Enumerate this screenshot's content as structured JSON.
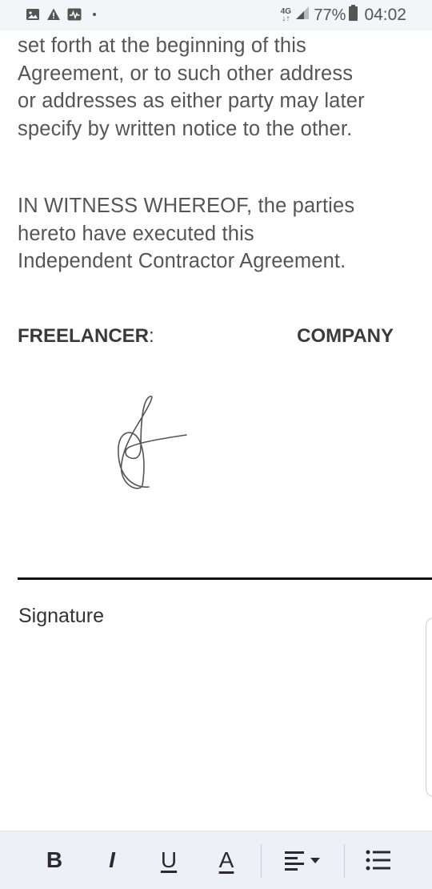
{
  "status_bar": {
    "left_icons": [
      "image-icon",
      "warning-icon",
      "activity-icon",
      "notification-dot"
    ],
    "network_type": "4G",
    "battery_percent": "77%",
    "time": "04:02"
  },
  "document": {
    "paragraph1_lines": [
      "set forth at the beginning of this",
      "Agreement, or to such other address",
      "or addresses as either party may later",
      "specify by written notice to the other."
    ],
    "paragraph2_lines": [
      "IN WITNESS WHEREOF, the parties",
      "hereto have executed this",
      "Independent Contractor Agreement."
    ],
    "party_left": "FREELANCER",
    "party_left_colon": ":",
    "party_right": "COMPANY",
    "signature_label": "Signature"
  },
  "toolbar": {
    "bold": "B",
    "italic": "I",
    "underline": "U",
    "text_color": "A",
    "align_icon": "align-left-icon",
    "list_icon": "bulleted-list-icon"
  },
  "colors": {
    "text": "#555555",
    "heading": "#3a3a3a",
    "toolbar_bg": "#edf1f7",
    "status_bg": "#f4f5f9"
  }
}
